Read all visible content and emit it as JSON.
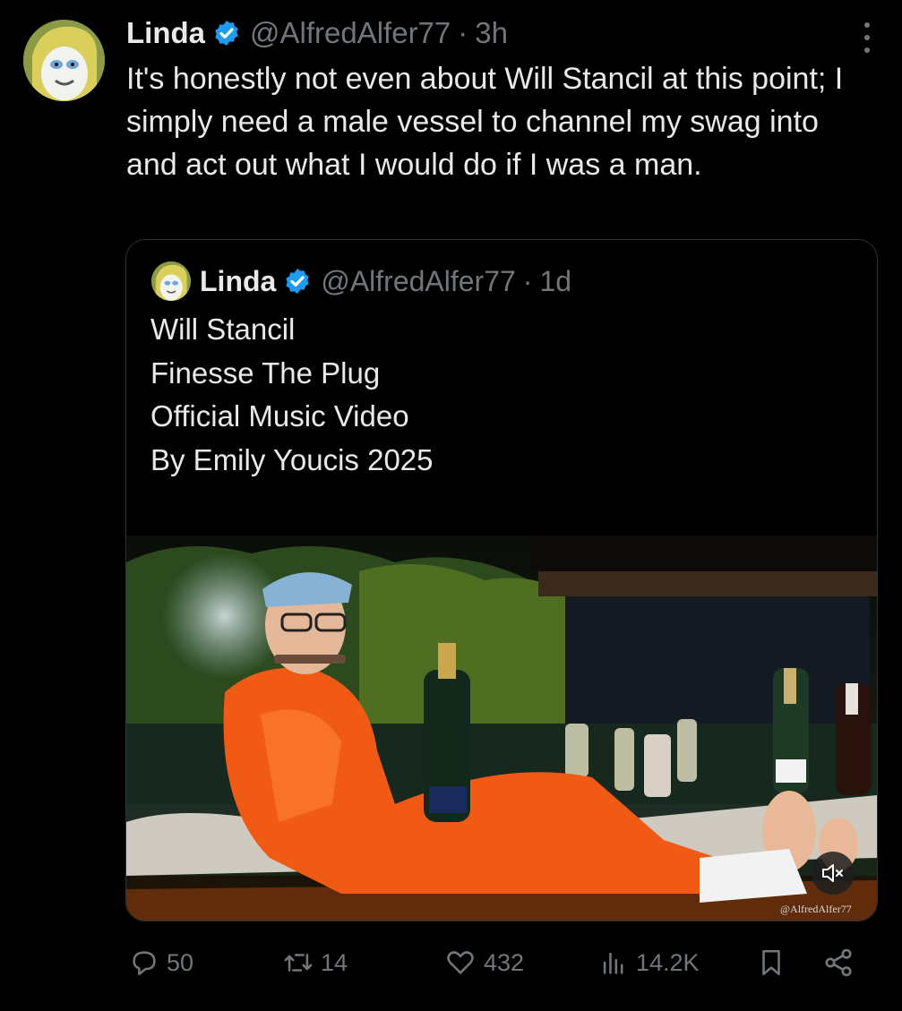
{
  "post": {
    "author_name": "Linda",
    "handle": "@AlfredAlfer77",
    "separator": "·",
    "time": "3h",
    "text": "It's honestly not even about Will Stancil at this point; I simply need a male vessel to channel my swag into and act out what I would do if I was a man."
  },
  "quoted_post": {
    "author_name": "Linda",
    "handle": "@AlfredAlfer77",
    "separator": "·",
    "time": "1d",
    "lines": [
      "Will Stancil",
      "Finesse The Plug",
      "Official Music Video",
      "By Emily Youcis 2025"
    ],
    "video_watermark": "@AlfredAlfer77",
    "mute_icon": "volume-muted-icon"
  },
  "actions": {
    "replies": "50",
    "reposts": "14",
    "likes": "432",
    "views": "14.2K"
  },
  "colors": {
    "background": "#000000",
    "text_primary": "#e7e9ea",
    "text_secondary": "#71767b",
    "verified_badge": "#1d9bf0",
    "border": "#2f3336"
  }
}
